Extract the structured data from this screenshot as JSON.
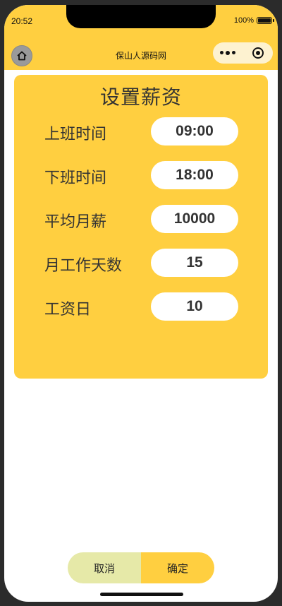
{
  "status_bar": {
    "time": "20:52",
    "battery": "100%"
  },
  "nav": {
    "title": "保山人源码网"
  },
  "panel": {
    "title": "设置薪资",
    "rows": [
      {
        "label": "上班时间",
        "value": "09:00"
      },
      {
        "label": "下班时间",
        "value": "18:00"
      },
      {
        "label": "平均月薪",
        "value": "10000"
      },
      {
        "label": "月工作天数",
        "value": "15"
      },
      {
        "label": "工资日",
        "value": "10"
      }
    ]
  },
  "actions": {
    "cancel": "取消",
    "confirm": "确定"
  },
  "colors": {
    "accent": "#ffcf40",
    "cancel_bg": "#e6e9a8",
    "field_bg": "#ffffff"
  },
  "icons": {
    "home": "home-icon",
    "more": "more-dots-icon",
    "close": "target-close-icon",
    "battery": "battery-icon"
  }
}
